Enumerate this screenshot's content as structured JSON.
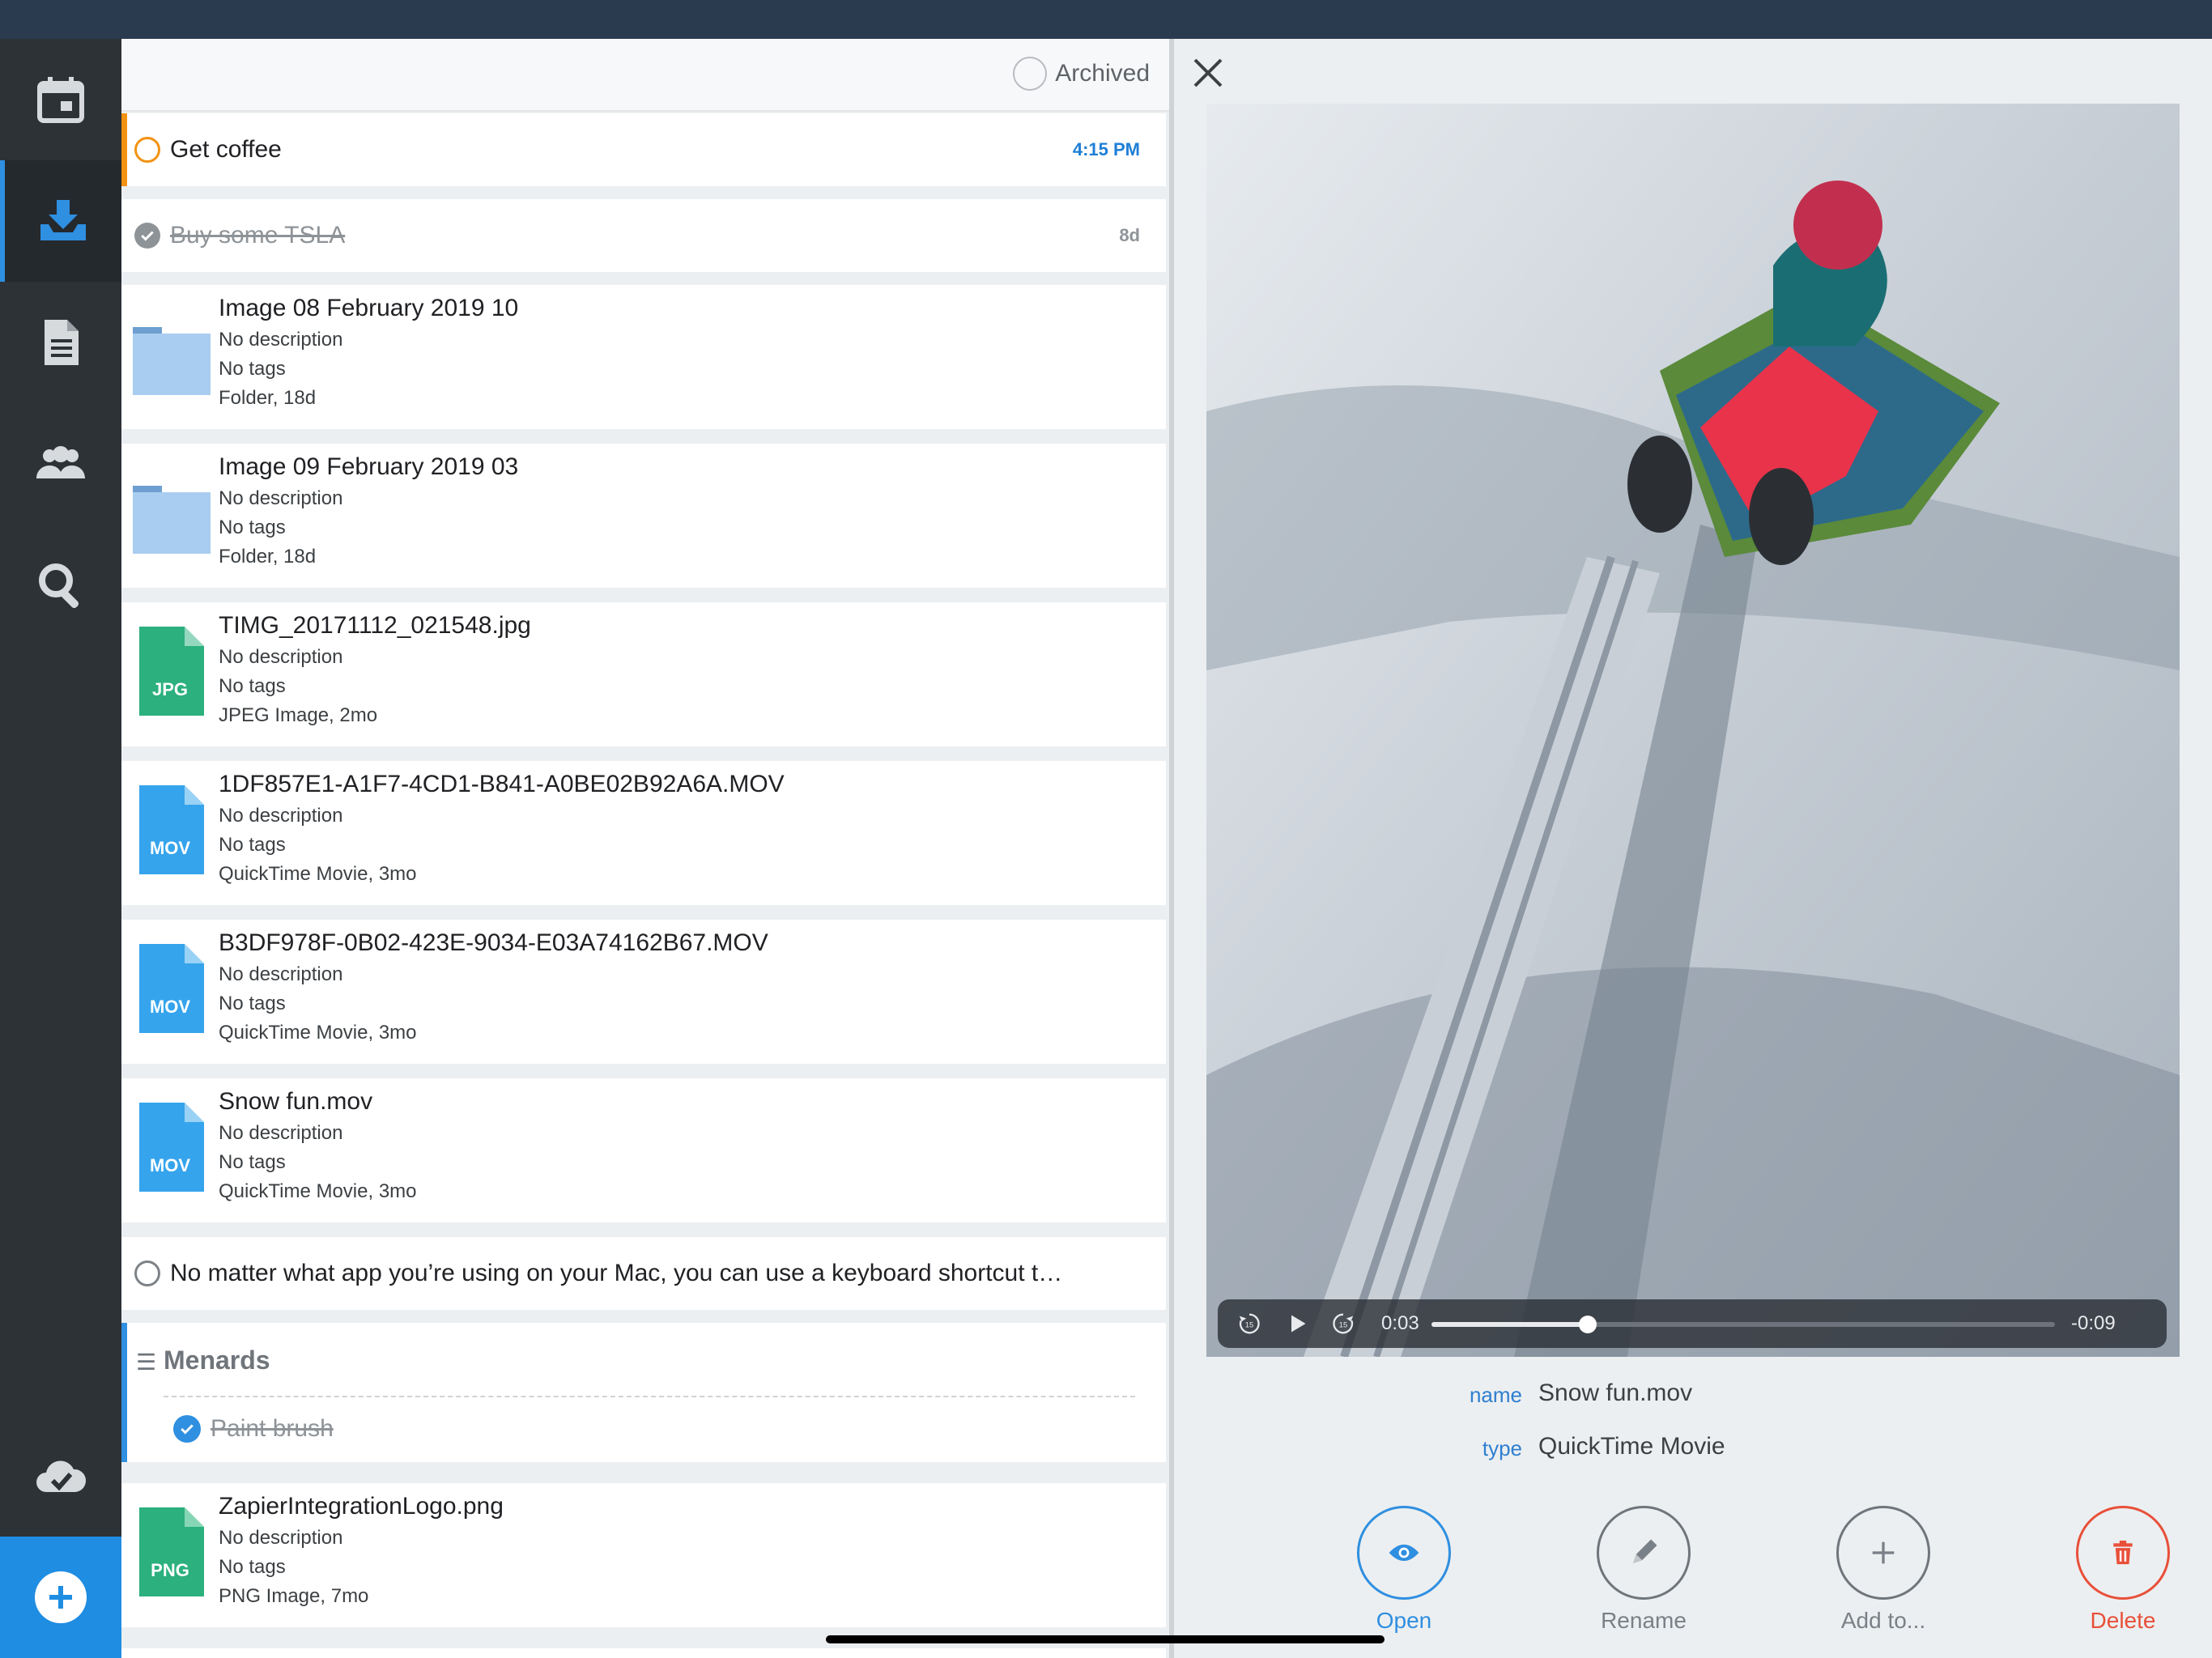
{
  "archived_label": "Archived",
  "tasks": [
    {
      "title": "Get coffee",
      "meta": "4:15 PM",
      "done": false
    },
    {
      "title": "Buy some TSLA",
      "meta": "8d",
      "done": true
    }
  ],
  "files": [
    {
      "name": "Image 08 February 2019 10",
      "desc": "No description",
      "tags": "No tags",
      "info": "Folder, 18d",
      "kind": "folder",
      "badge": ""
    },
    {
      "name": "Image 09 February 2019 03",
      "desc": "No description",
      "tags": "No tags",
      "info": "Folder, 18d",
      "kind": "folder",
      "badge": ""
    },
    {
      "name": "TIMG_20171112_021548.jpg",
      "desc": "No description",
      "tags": "No tags",
      "info": "JPEG Image, 2mo",
      "kind": "doc",
      "badge": "JPG",
      "color": "#2bb07e"
    },
    {
      "name": "1DF857E1-A1F7-4CD1-B841-A0BE02B92A6A.MOV",
      "desc": "No description",
      "tags": "No tags",
      "info": "QuickTime Movie, 3mo",
      "kind": "doc",
      "badge": "MOV",
      "color": "#35a4ec"
    },
    {
      "name": "B3DF978F-0B02-423E-9034-E03A74162B67.MOV",
      "desc": "No description",
      "tags": "No tags",
      "info": "QuickTime Movie, 3mo",
      "kind": "doc",
      "badge": "MOV",
      "color": "#35a4ec"
    },
    {
      "name": "Snow fun.mov",
      "desc": "No description",
      "tags": "No tags",
      "info": "QuickTime Movie, 3mo",
      "kind": "doc",
      "badge": "MOV",
      "color": "#35a4ec"
    }
  ],
  "note_task": "No matter what app you’re using on your Mac, you can use a keyboard shortcut t…",
  "list_group": {
    "title": "Menards",
    "item": "Paint brush"
  },
  "last_file": {
    "name": "ZapierIntegrationLogo.png",
    "desc": "No description",
    "tags": "No tags",
    "info": "PNG Image, 7mo",
    "badge": "PNG",
    "color": "#2bb07e"
  },
  "video": {
    "elapsed": "0:03",
    "remaining": "-0:09",
    "progress": 0.25
  },
  "properties": {
    "name_key": "name",
    "name_val": "Snow fun.mov",
    "type_key": "type",
    "type_val": "QuickTime Movie"
  },
  "actions": {
    "open": "Open",
    "rename": "Rename",
    "add": "Add to...",
    "delete": "Delete"
  },
  "colors": {
    "accent": "#2f8fe0",
    "orange": "#f39212",
    "delete": "#e8503a",
    "sidebar": "#2d3237"
  }
}
